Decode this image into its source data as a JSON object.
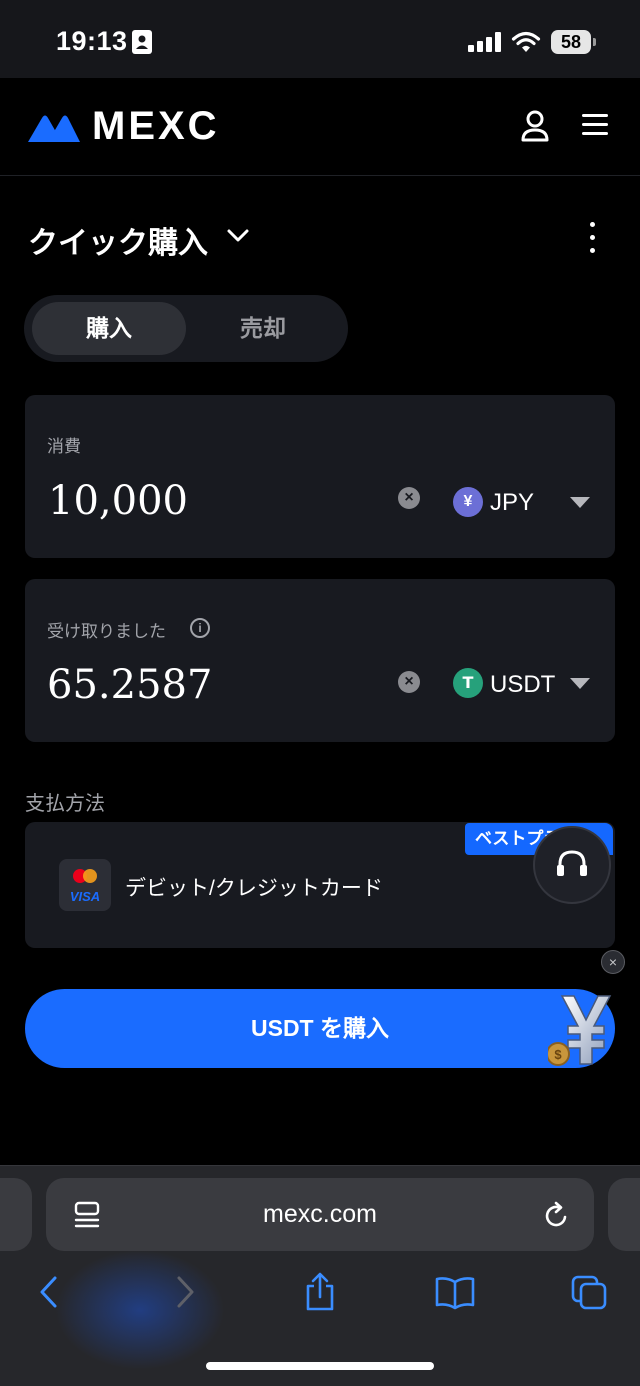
{
  "status_bar": {
    "time": "19:13",
    "battery": "58"
  },
  "header": {
    "brand": "MEXC"
  },
  "page": {
    "title": "クイック購入"
  },
  "tabs": {
    "buy": "購入",
    "sell": "売却"
  },
  "spend": {
    "label": "消費",
    "amount": "10,000",
    "currency": "JPY",
    "currency_symbol": "¥",
    "coin_color": "#6c6fd6"
  },
  "receive": {
    "label": "受け取りました",
    "amount": "65.2587",
    "currency": "USDT",
    "currency_symbol": "T",
    "coin_color": "#26a17b"
  },
  "payment": {
    "label": "支払方法",
    "method": "デビット/クレジットカード",
    "card_brand": "VISA",
    "badge": "ベストプライス"
  },
  "actions": {
    "buy_button": "USDT を購入"
  },
  "browser": {
    "url": "mexc.com"
  },
  "colors": {
    "accent": "#1a6cff",
    "card_bg": "#181a20"
  }
}
